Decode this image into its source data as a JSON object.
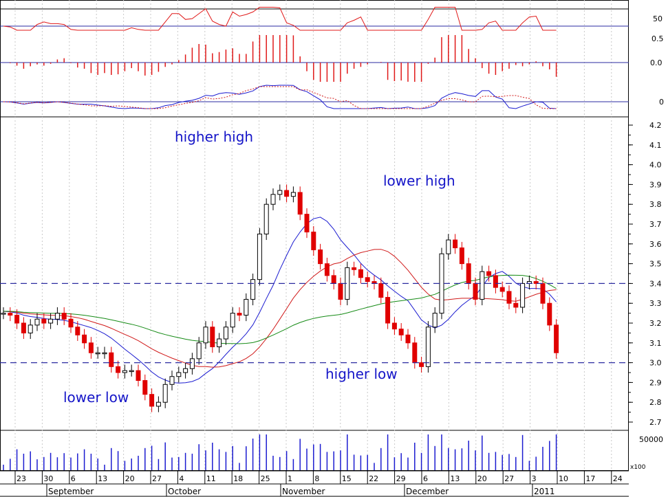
{
  "chart_data": {
    "type": "candlestick",
    "series": [
      {
        "name": "",
        "values": [
          3.25,
          3.24,
          3.2,
          3.15,
          3.19,
          3.22,
          3.2,
          3.22,
          3.25,
          3.22,
          3.18,
          3.14,
          3.1,
          3.05,
          3.05,
          3.05,
          2.98,
          2.95,
          2.96,
          2.96,
          2.91,
          2.84,
          2.78,
          2.8,
          2.89,
          2.93,
          2.95,
          2.97,
          3.02,
          3.1,
          3.18,
          3.08,
          3.12,
          3.18,
          3.25,
          3.24,
          3.32,
          3.42,
          3.65,
          3.8,
          3.85,
          3.87,
          3.84,
          3.86,
          3.75,
          3.66,
          3.57,
          3.5,
          3.44,
          3.4,
          3.32,
          3.48,
          3.47,
          3.43,
          3.41,
          3.4,
          3.33,
          3.2,
          3.17,
          3.14,
          3.1,
          3.0,
          2.98,
          3.18,
          3.25,
          3.55,
          3.62,
          3.58,
          3.5,
          3.4,
          3.32,
          3.46,
          3.44,
          3.38,
          3.36,
          3.3,
          3.28,
          3.4,
          3.41,
          3.4,
          3.3,
          3.19,
          3.05
        ]
      }
    ],
    "indicator_values": {
      "oscillator_ref": "50",
      "histogram_ticks": [
        "0.5",
        "0.0"
      ],
      "macd_zero": "0"
    },
    "moving_averages": [
      "blue",
      "red",
      "green"
    ],
    "horizontal_levels": [
      3.4,
      3.0
    ],
    "annotations": [
      "higher high",
      "lower high",
      "lower low",
      "higher low"
    ],
    "y_ticks": [
      "4.2",
      "4.1",
      "4.0",
      "3.9",
      "3.8",
      "3.7",
      "3.6",
      "3.5",
      "3.4",
      "3.3",
      "3.2",
      "3.1",
      "3.0",
      "2.9",
      "2.8",
      "2.7"
    ],
    "ylim": [
      2.65,
      4.23
    ],
    "volume_tick": "50000",
    "volume_unit": "x100",
    "x_tick_labels": [
      "23",
      "30",
      "6",
      "13",
      "20",
      "27",
      "4",
      "11",
      "18",
      "25",
      "1",
      "8",
      "15",
      "22",
      "29",
      "6",
      "13",
      "20",
      "27",
      "3",
      "10",
      "17",
      "24"
    ],
    "month_labels": [
      "September",
      "October",
      "November",
      "December",
      "2011"
    ],
    "colors": {
      "up": "#000000",
      "down": "#e00000",
      "ma_short": "#1a1ad0",
      "ma_mid": "#d01818",
      "ma_long": "#148a14",
      "level": "#2a2aa0",
      "annotation": "#1515c8",
      "volume": "#1a1ad0",
      "oscillator": "#e01818"
    }
  }
}
